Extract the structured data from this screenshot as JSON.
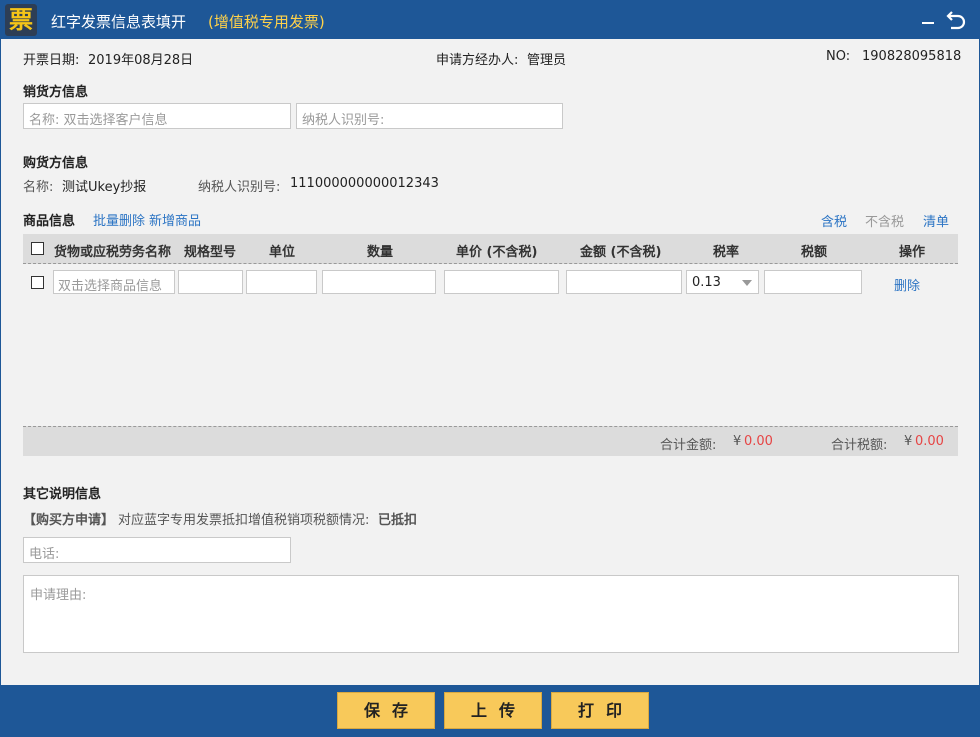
{
  "window": {
    "logo_char": "票",
    "title": "红字发票信息表填开",
    "subtitle": "(增值税专用发票)"
  },
  "header": {
    "date_label": "开票日期:",
    "date_value": "2019年08月28日",
    "agent_label": "申请方经办人:",
    "agent_value": "管理员",
    "no_label": "NO:",
    "no_value": "190828095818"
  },
  "seller": {
    "section_title": "销货方信息",
    "name_field": "名称: 双击选择客户信息",
    "taxid_field": "纳税人识别号:"
  },
  "buyer": {
    "section_title": "购货方信息",
    "name_label": "名称:",
    "name_value": "测试Ukey抄报",
    "taxid_label": "纳税人识别号:",
    "taxid_value": "111000000000012343"
  },
  "goods": {
    "section_title": "商品信息",
    "batch_delete": "批量删除",
    "add_item": "新增商品",
    "tax_included": "含税",
    "tax_excluded": "不含税",
    "clear": "清单",
    "columns": [
      "货物或应税劳务名称",
      "规格型号",
      "单位",
      "数量",
      "单价 (不含税)",
      "金额 (不含税)",
      "税率",
      "税额",
      "操作"
    ],
    "row": {
      "name_placeholder": "双击选择商品信息",
      "tax_rate": "0.13",
      "delete": "删除"
    },
    "totals": {
      "amount_label": "合计金额:",
      "amount_value": "¥",
      "amount_number": "0.00",
      "tax_label": "合计税额:",
      "tax_value": "¥",
      "tax_number": "0.00"
    }
  },
  "other": {
    "section_title": "其它说明信息",
    "buyer_apply": "【购买方申请】",
    "deduct_text": "对应蓝字专用发票抵扣增值税销项税额情况:",
    "deduct_status": "已抵扣",
    "phone_placeholder": "电话:",
    "reason_placeholder": "申请理由:"
  },
  "buttons": {
    "save": "保存",
    "upload": "上传",
    "print": "打印"
  },
  "colors": {
    "titlebar": "#1e5797",
    "accent_link": "#2b74c4",
    "subtitle": "#ffd24a",
    "button": "#f8c95a",
    "total_number": "#e64545"
  }
}
